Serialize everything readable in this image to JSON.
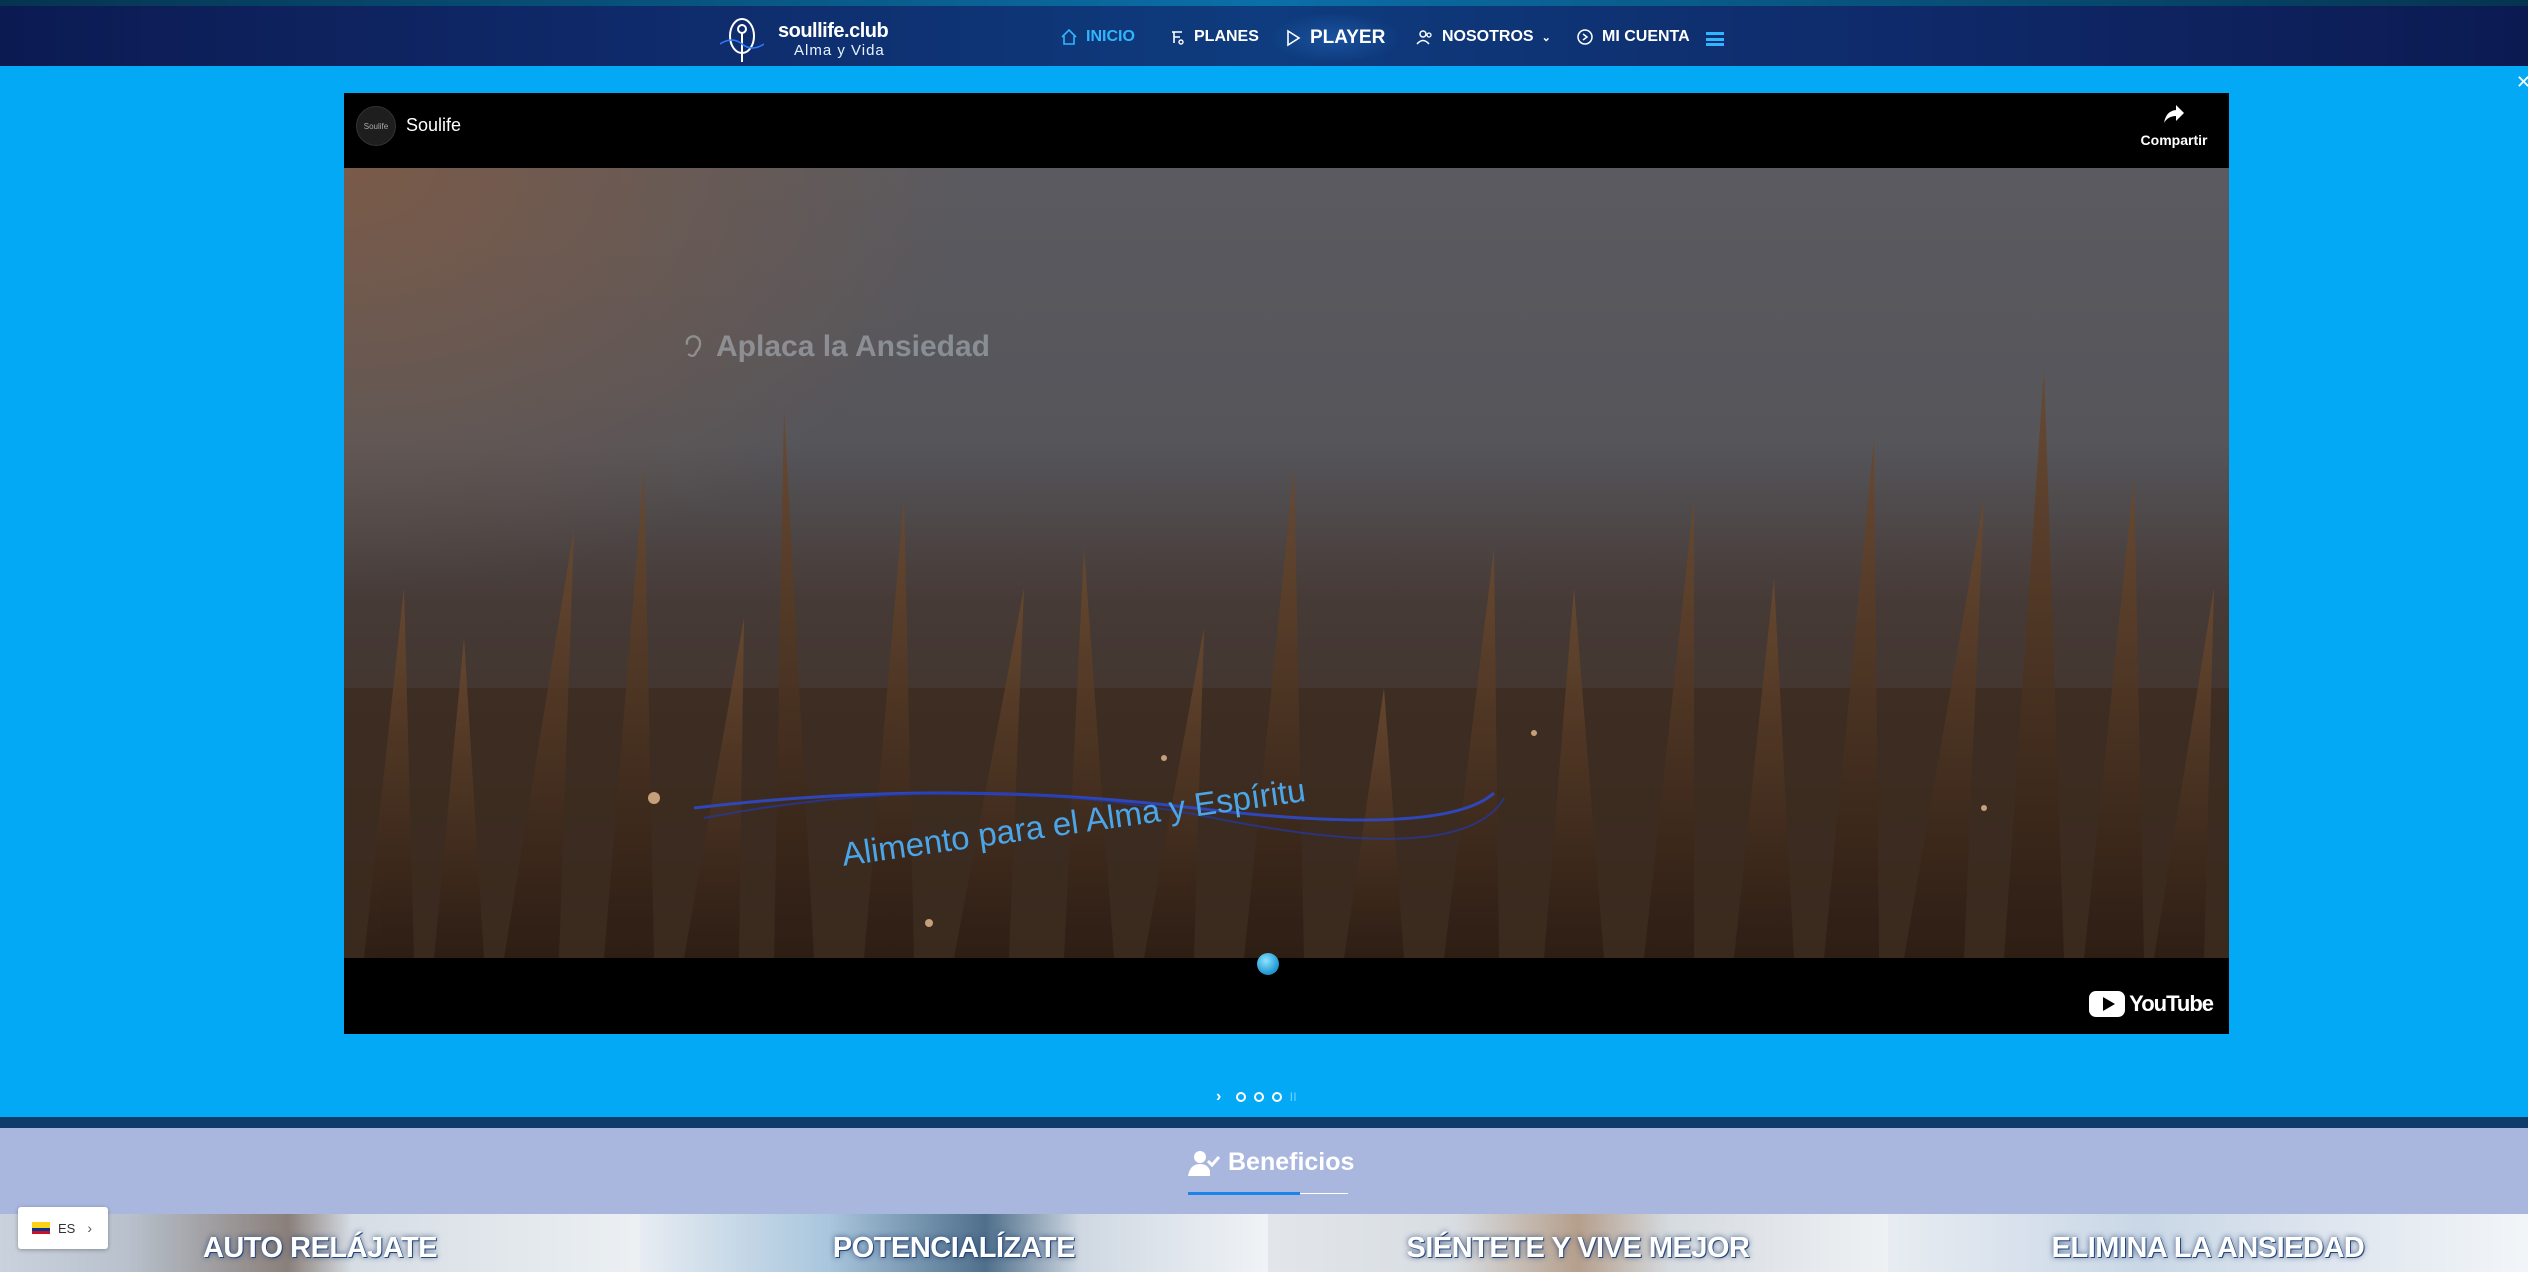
{
  "logo": {
    "title": "soullife.club",
    "subtitle": "Alma y Vida"
  },
  "nav": {
    "items": [
      {
        "label": "INICIO",
        "icon": "home-icon",
        "active": true
      },
      {
        "label": "PLANES",
        "icon": "music-icon"
      },
      {
        "label": "PLAYER",
        "icon": "play-icon"
      },
      {
        "label": "NOSOTROS",
        "icon": "users-icon",
        "has_dropdown": true
      },
      {
        "label": "MI CUENTA",
        "icon": "account-icon"
      }
    ],
    "menu_icon": "hamburger-icon",
    "close_glyph": "✕"
  },
  "video": {
    "channel": "Soulife",
    "avatar_text": "Soulife",
    "share_label": "Compartir",
    "overlay_title": "Aplaca la Ansiedad",
    "overlay_tagline": "Alimento para el Alma y Espíritu",
    "youtube_label": "YouTube"
  },
  "slider": {
    "next_glyph": "›",
    "dots": 3,
    "pause_glyph": "ll"
  },
  "benefits": {
    "title": "Beneficios",
    "cards": [
      {
        "label": "AUTO RELÁJATE"
      },
      {
        "label": "POTENCIALÍZATE"
      },
      {
        "label": "SIÉNTETE Y VIVE MEJOR"
      },
      {
        "label": "ELIMINA LA ANSIEDAD"
      }
    ]
  },
  "language": {
    "code": "ES",
    "chevron": "›"
  },
  "colors": {
    "page_bg": "#03a9f4",
    "nav_bg": "#0c1a52",
    "accent": "#2fb6ff",
    "benefits_band": "#a9b7df"
  }
}
